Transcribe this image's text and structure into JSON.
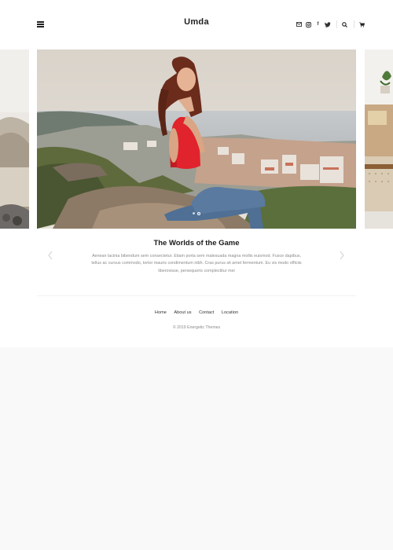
{
  "header": {
    "logo": "Umda",
    "menu_icon": "hamburger-icon",
    "social_icons": [
      "envelope-icon",
      "instagram-icon",
      "facebook-icon",
      "twitter-icon"
    ],
    "facebook_glyph": "f",
    "tool_icons": [
      "search-icon",
      "cart-icon"
    ]
  },
  "slider": {
    "title": "The Worlds of the Game",
    "text": "Aenean lacinia bibendum sem consectetur. Etiam porta sem malesuada magna mollis euismod. Fusce dapibus, tellus ac cursus commodo, tortor mauris condimentum nibh. Cras purus sit amet fermentum. Eu vis modo officiis liberovisse, persequeris complectitur mei",
    "slide_count": 2,
    "active_slide": 2
  },
  "footer": {
    "nav": [
      {
        "label": "Home"
      },
      {
        "label": "About us"
      },
      {
        "label": "Contact"
      },
      {
        "label": "Location"
      }
    ],
    "copyright": "© 2019 Energetic Themes"
  },
  "colors": {
    "page_bg": "#ffffff",
    "outer_bg": "#f9f9f9",
    "shirt": "#e8232b",
    "text_dark": "#1a1a1a",
    "text_muted": "#8a8a8a"
  }
}
